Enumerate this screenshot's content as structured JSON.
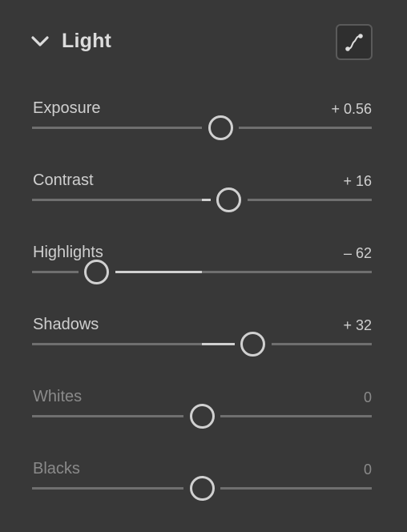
{
  "panel": {
    "title": "Light",
    "collapse_icon": "chevron-down-icon",
    "curve_icon": "tone-curve-icon"
  },
  "sliders": [
    {
      "label": "Exposure",
      "value": "+ 0.56",
      "position": 0.555,
      "dim": false
    },
    {
      "label": "Contrast",
      "value": "+ 16",
      "position": 0.58,
      "dim": false
    },
    {
      "label": "Highlights",
      "value": "– 62",
      "position": 0.19,
      "dim": false
    },
    {
      "label": "Shadows",
      "value": "+ 32",
      "position": 0.65,
      "dim": false
    },
    {
      "label": "Whites",
      "value": "0",
      "position": 0.5,
      "dim": true
    },
    {
      "label": "Blacks",
      "value": "0",
      "position": 0.5,
      "dim": true
    }
  ],
  "colors": {
    "background": "#383838",
    "track": "#6f6f6f",
    "active": "#d0d0d0"
  }
}
